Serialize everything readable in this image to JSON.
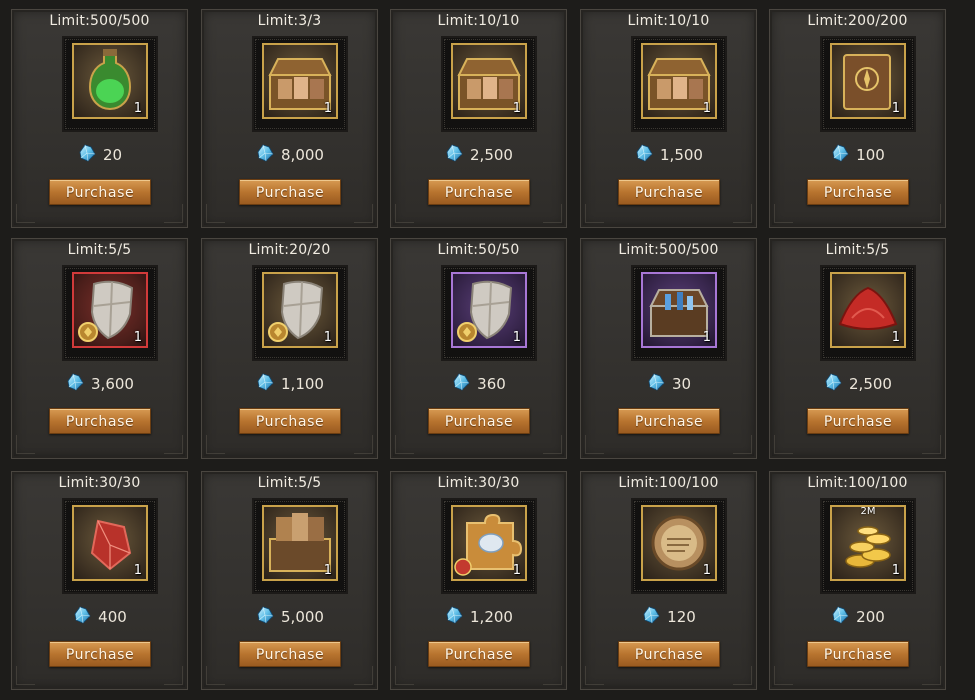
{
  "currency_icon": "blue-crystal-gem-icon",
  "items": [
    {
      "id": "potion",
      "limit": "Limit:500/500",
      "icon": "green-potion-flask-icon",
      "quantity": "1",
      "price": "20",
      "button": "Purchase",
      "rarity": "gold"
    },
    {
      "id": "chest-a",
      "limit": "Limit:3/3",
      "icon": "hero-portrait-chest-icon",
      "quantity": "1",
      "price": "8,000",
      "button": "Purchase",
      "rarity": "gold"
    },
    {
      "id": "chest-b",
      "limit": "Limit:10/10",
      "icon": "hero-portrait-chest-icon",
      "quantity": "1",
      "price": "2,500",
      "button": "Purchase",
      "rarity": "gold"
    },
    {
      "id": "chest-c",
      "limit": "Limit:10/10",
      "icon": "hero-portrait-chest-icon",
      "quantity": "1",
      "price": "1,500",
      "button": "Purchase",
      "rarity": "gold"
    },
    {
      "id": "tome",
      "limit": "Limit:200/200",
      "icon": "spell-tome-book-icon",
      "quantity": "1",
      "price": "100",
      "button": "Purchase",
      "rarity": "gold"
    },
    {
      "id": "shield-red",
      "limit": "Limit:5/5",
      "icon": "shield-icon",
      "quantity": "1",
      "price": "3,600",
      "button": "Purchase",
      "rarity": "red"
    },
    {
      "id": "shield-gold",
      "limit": "Limit:20/20",
      "icon": "shield-icon",
      "quantity": "1",
      "price": "1,100",
      "button": "Purchase",
      "rarity": "gold"
    },
    {
      "id": "shield-purple",
      "limit": "Limit:50/50",
      "icon": "shield-icon",
      "quantity": "1",
      "price": "360",
      "button": "Purchase",
      "rarity": "purple"
    },
    {
      "id": "chest-purple",
      "limit": "Limit:500/500",
      "icon": "treasure-chest-icon",
      "quantity": "1",
      "price": "30",
      "button": "Purchase",
      "rarity": "purple"
    },
    {
      "id": "red-cloth",
      "limit": "Limit:5/5",
      "icon": "red-cloth-icon",
      "quantity": "1",
      "price": "2,500",
      "button": "Purchase",
      "rarity": "gold"
    },
    {
      "id": "red-crystal",
      "limit": "Limit:30/30",
      "icon": "red-crystal-icon",
      "quantity": "1",
      "price": "400",
      "button": "Purchase",
      "rarity": "gold"
    },
    {
      "id": "card-chest",
      "limit": "Limit:5/5",
      "icon": "hero-card-chest-icon",
      "quantity": "1",
      "price": "5,000",
      "button": "Purchase",
      "rarity": "gold"
    },
    {
      "id": "puzzle",
      "limit": "Limit:30/30",
      "icon": "puzzle-piece-icon",
      "quantity": "1",
      "price": "1,200",
      "button": "Purchase",
      "rarity": "gold"
    },
    {
      "id": "scroll",
      "limit": "Limit:100/100",
      "icon": "scroll-icon",
      "quantity": "1",
      "price": "120",
      "button": "Purchase",
      "rarity": "gold"
    },
    {
      "id": "gold-coins",
      "limit": "Limit:100/100",
      "icon": "gold-coins-icon",
      "quantity": "1",
      "price": "200",
      "button": "Purchase",
      "rarity": "gold",
      "tag": "2M"
    }
  ]
}
